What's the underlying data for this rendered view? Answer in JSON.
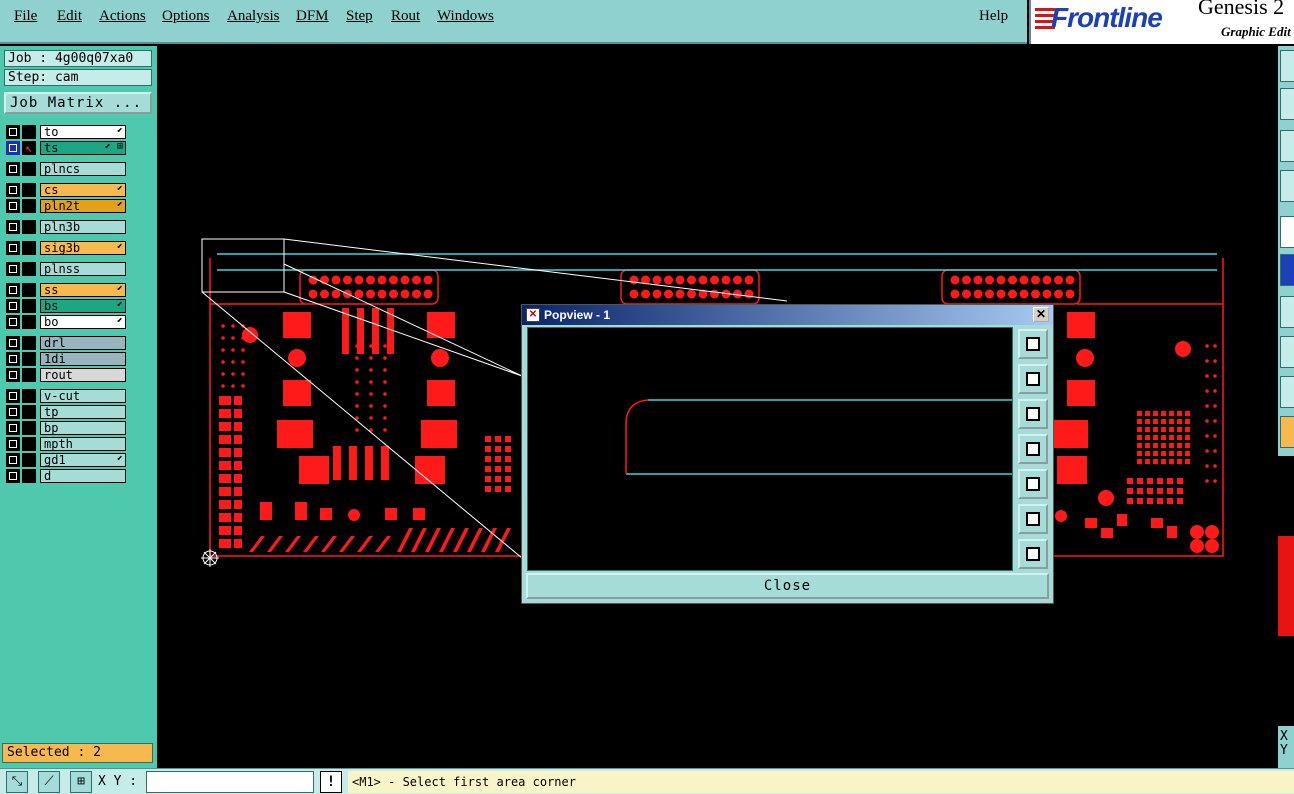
{
  "menubar": {
    "items": [
      "File",
      "Edit",
      "Actions",
      "Options",
      "Analysis",
      "DFM",
      "Step",
      "Rout",
      "Windows"
    ],
    "help": "Help"
  },
  "logo": {
    "brand": "Frontline",
    "product": "Genesis 2",
    "subtitle": "Graphic Edit"
  },
  "job": {
    "job_line": "Job : 4g00q07xa0",
    "step_line": "Step: cam",
    "matrix_button": "Job Matrix ..."
  },
  "layers": [
    {
      "name": "to",
      "color": "#ffffff",
      "mark": "⬋"
    },
    {
      "name": "ts",
      "color": "#1ea583",
      "mark": "⬋ ⊞",
      "active": true
    },
    {
      "name": "plncs",
      "color": "#a6dcd8",
      "mark": ""
    },
    {
      "name": "cs",
      "color": "#f7b84d",
      "mark": "⬋"
    },
    {
      "name": "pln2t",
      "color": "#e3a01b",
      "mark": "⬋"
    },
    {
      "name": "pln3b",
      "color": "#a6dcd8",
      "mark": ""
    },
    {
      "name": "sig3b",
      "color": "#f7b84d",
      "mark": "⬋"
    },
    {
      "name": "plnss",
      "color": "#a6dcd8",
      "mark": ""
    },
    {
      "name": "ss",
      "color": "#f7b84d",
      "mark": "⬋"
    },
    {
      "name": "bs",
      "color": "#1ea583",
      "mark": "⬋"
    },
    {
      "name": "bo",
      "color": "#ffffff",
      "mark": "⬋"
    },
    {
      "name": "drl",
      "color": "#98b4be",
      "mark": ""
    },
    {
      "name": "1di",
      "color": "#98b4be",
      "mark": ""
    },
    {
      "name": "rout",
      "color": "#d8d8d8",
      "mark": ""
    },
    {
      "name": "v-cut",
      "color": "#a6dcd8",
      "mark": ""
    },
    {
      "name": "tp",
      "color": "#a6dcd8",
      "mark": ""
    },
    {
      "name": "bp",
      "color": "#a6dcd8",
      "mark": ""
    },
    {
      "name": "mpth",
      "color": "#a6dcd8",
      "mark": ""
    },
    {
      "name": "gd1",
      "color": "#a6dcd8",
      "mark": "⬋"
    },
    {
      "name": "d",
      "color": "#a6dcd8",
      "mark": ""
    }
  ],
  "selected": "Selected : 2",
  "popview": {
    "title": "Popview - 1",
    "close_label": "Close",
    "tools": [
      "zoom-fit-icon",
      "pan-up-icon",
      "pan-down-icon",
      "pan-left-icon",
      "pan-right-icon",
      "zoom-in-icon",
      "zoom-out-icon"
    ]
  },
  "bottombar": {
    "xy_label": "X Y :",
    "xy_value": "",
    "status": "<M1> - Select first area corner",
    "warn": "!"
  },
  "rightbar": {
    "xy_side": "X\nY"
  },
  "colors": {
    "panel": "#4fc9ad",
    "menubar": "#8fd1cf",
    "pcb_red": "#ff1a1a",
    "outline_cyan": "#3cd4dc"
  }
}
